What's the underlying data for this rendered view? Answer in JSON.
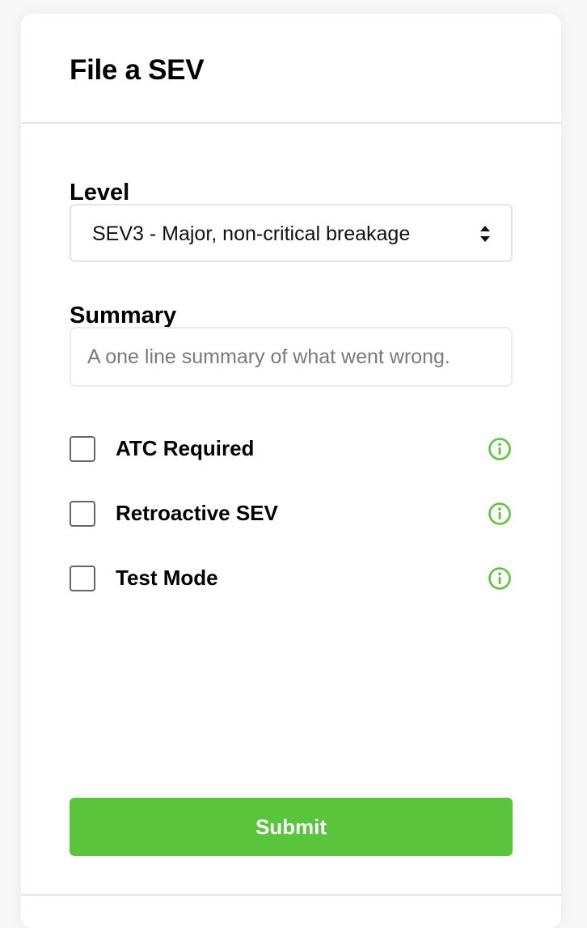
{
  "form": {
    "title": "File a SEV",
    "level": {
      "label": "Level",
      "selected": "SEV3 - Major, non-critical breakage"
    },
    "summary": {
      "label": "Summary",
      "value": "",
      "placeholder": "A one line summary of what went wrong."
    },
    "options": [
      {
        "label": "ATC Required",
        "checked": false,
        "info_icon": "info-circle-icon"
      },
      {
        "label": "Retroactive SEV",
        "checked": false,
        "info_icon": "info-circle-icon"
      },
      {
        "label": "Test Mode",
        "checked": false,
        "info_icon": "info-circle-icon"
      }
    ],
    "submit_label": "Submit"
  },
  "colors": {
    "accent": "#5ac53c",
    "info_icon": "#5ac53c",
    "divider": "#e6e6e6",
    "background": "#f7f7f7"
  }
}
